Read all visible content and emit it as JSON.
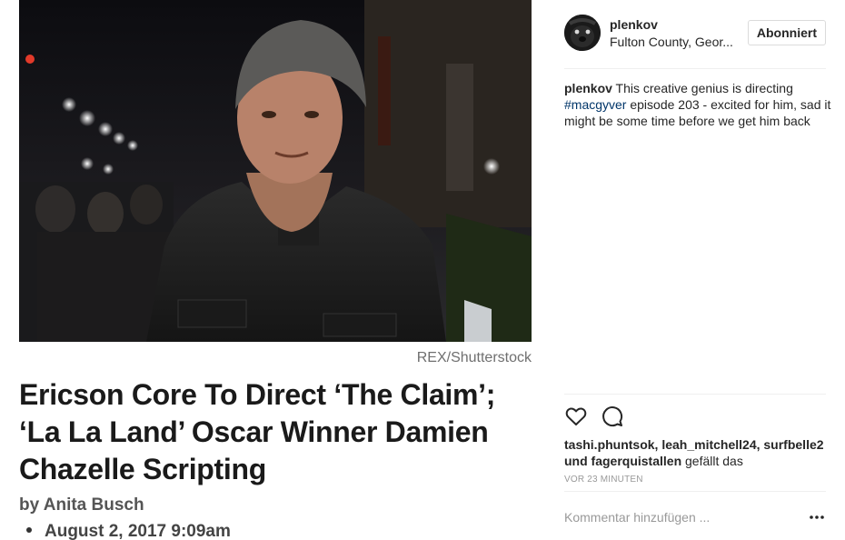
{
  "article": {
    "photo_credit": "REX/Shutterstock",
    "headline": "Ericson Core To Direct ‘The Claim’; ‘La La Land’ Oscar Winner Damien Chazelle Scripting",
    "byline": "by Anita Busch",
    "date": "August 2, 2017 9:09am"
  },
  "post": {
    "username": "plenkov",
    "location": "Fulton County, Geor...",
    "follow_label": "Abonniert",
    "caption": {
      "user": "plenkov",
      "text_before": "This creative genius is directing",
      "hashtag": "#macgyver",
      "text_after": "episode 203 - excited for him, sad it might be some time before we get him back"
    },
    "likes": {
      "users": "tashi.phuntsok, leah_mitchell24, surfbelle2 und fagerquistallen",
      "suffix": "gefällt das"
    },
    "timestamp": "VOR 23 MINUTEN",
    "comment_placeholder": "Kommentar hinzufügen ..."
  },
  "icons": {
    "like": "heart-icon",
    "comment": "comment-icon",
    "more": "more-options-icon"
  },
  "colors": {
    "hashtag": "#003569",
    "text": "#262626",
    "muted": "#999999",
    "border": "#dbdbdb"
  }
}
